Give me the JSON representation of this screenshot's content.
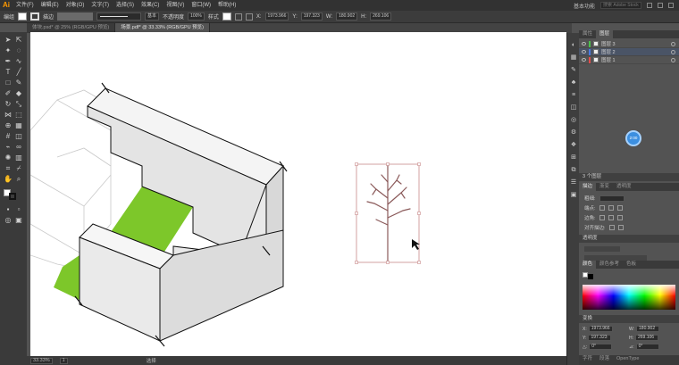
{
  "app": {
    "logo": "Ai",
    "workspace": "基本功能",
    "search_placeholder": "搜索 Adobe Stock"
  },
  "menu": [
    "文件(F)",
    "编辑(E)",
    "对象(O)",
    "文字(T)",
    "选择(S)",
    "效果(C)",
    "视图(V)",
    "窗口(W)",
    "帮助(H)"
  ],
  "control": {
    "object_label": "编组",
    "stroke_label": "描边",
    "stroke_style": "基本",
    "opacity_label": "不透明度",
    "opacity_value": "100%",
    "style_label": "样式",
    "x_label": "X:",
    "x_value": "1973.966",
    "y_label": "Y:",
    "y_value": "197.323",
    "w_label": "W:",
    "w_value": "180.902",
    "h_label": "H:",
    "h_value": "269.106"
  },
  "tabs": [
    {
      "label": "体块.psd* @ 25% (RGB/GPU 预览)",
      "active": false
    },
    {
      "label": "场景.pdf* @ 33.33% (RGB/GPU 预览)",
      "active": true
    }
  ],
  "status": {
    "zoom": "33.33%",
    "page": "1",
    "tool": "选择"
  },
  "layers_panel": {
    "tabs": [
      "属性",
      "图层"
    ],
    "layers": [
      {
        "name": "图层 3",
        "color": "#4cc04c",
        "selected": false
      },
      {
        "name": "图层 2",
        "color": "#4c7ae0",
        "selected": true
      },
      {
        "name": "图层 1",
        "color": "#e04c4c",
        "selected": false
      }
    ],
    "badge": "2:00",
    "footer": "3 个图层"
  },
  "transform_panel": {
    "tabs": [
      "描边",
      "渐变",
      "透明度"
    ],
    "weight_label": "粗细:",
    "cap_label": "端点:",
    "corner_label": "边角:",
    "align_label": "对齐描边:"
  },
  "appearance_panel": {
    "title": "透明度"
  },
  "color_panel": {
    "tabs": [
      "颜色",
      "颜色参考",
      "色板"
    ]
  },
  "bottom_panel": {
    "title": "变换",
    "x_label": "X:",
    "x_value": "1973.966",
    "y_label": "Y:",
    "y_value": "197.323",
    "w_label": "W:",
    "w_value": "180.902",
    "h_label": "H:",
    "h_value": "269.106",
    "angle_label": "△:",
    "angle_value": "0°",
    "shear_label": "⊿:",
    "shear_value": "0°",
    "footer_tabs": [
      "字符",
      "段落",
      "OpenType"
    ]
  }
}
